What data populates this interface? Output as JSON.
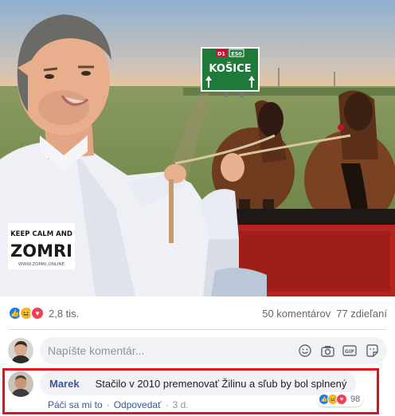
{
  "photo": {
    "road_sign": {
      "route_a": "D1",
      "route_b": "E50",
      "destination": "KOŠICE"
    },
    "watermark": {
      "line1": "KEEP CALM AND",
      "logo": "ZOMRI",
      "url": "WWW.ZOMRI.ONLINE"
    }
  },
  "stats": {
    "reactions": [
      "like",
      "haha",
      "love"
    ],
    "reaction_count": "2,8 tis.",
    "comments": "50 komentárov",
    "shares": "77 zdieľaní"
  },
  "composer": {
    "placeholder": "Napíšte komentár...",
    "icons": [
      "emoji-icon",
      "camera-icon",
      "gif-icon",
      "sticker-icon"
    ]
  },
  "comment": {
    "author": "Marek",
    "text": "Stačilo v 2010 premenovať Žilinu a sľub by bol splnený",
    "reactions": [
      "like",
      "haha",
      "love"
    ],
    "reaction_count": "98",
    "like_action": "Páči sa mi to",
    "reply_action": "Odpovedať",
    "time": "3 d.",
    "highlight_color": "#e0111b"
  },
  "colors": {
    "link": "#385898",
    "like": "#1877f2",
    "haha": "#f7b125",
    "love": "#f33e58",
    "bubble": "#f0f2f5"
  }
}
